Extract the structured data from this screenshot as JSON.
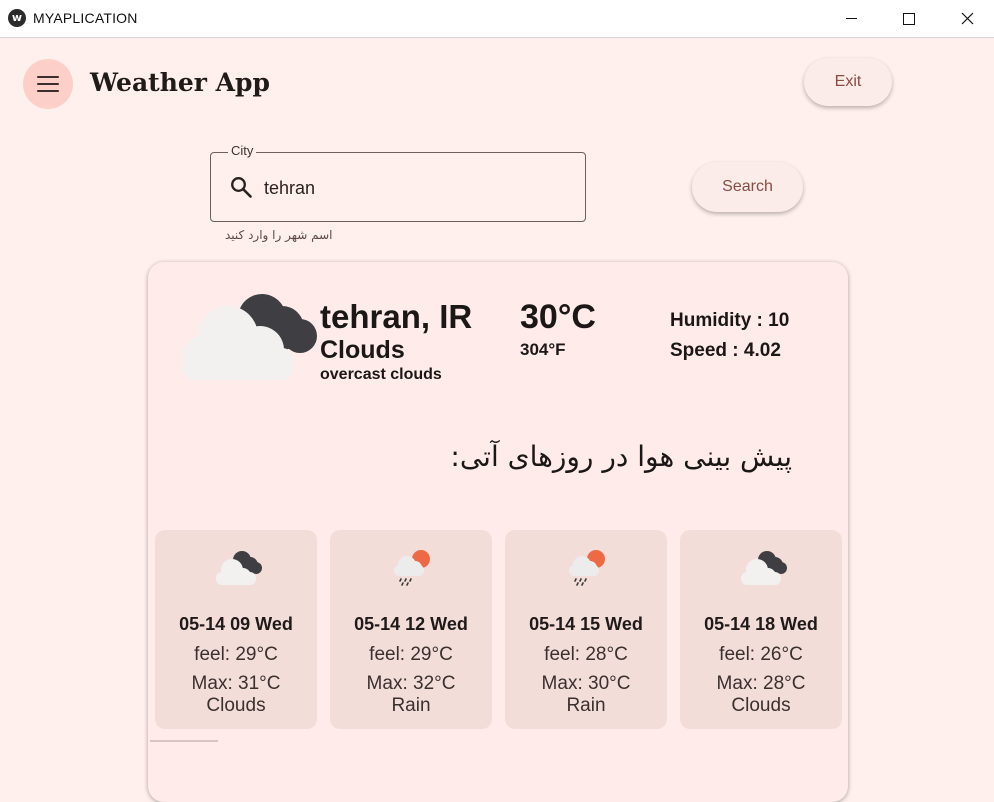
{
  "window": {
    "title": "MYAPLICATION",
    "icon_name": "kivy-logo-icon",
    "controls": [
      "minimize-icon",
      "maximize-icon",
      "close-icon"
    ]
  },
  "header": {
    "app_title": "Weather App",
    "exit_label": "Exit"
  },
  "search": {
    "field_label": "City",
    "value": "tehran",
    "helper_text": "اسم شهر را وارد کنید",
    "button_label": "Search"
  },
  "current": {
    "city": "tehran, IR",
    "main": "Clouds",
    "description": "overcast clouds",
    "temp_c": "30°C",
    "temp_f": "304°F",
    "humidity": "Humidity : 10",
    "speed": "Speed : 4.02",
    "icon": "overcast-clouds-icon"
  },
  "forecast_title": "پیش بینی هوا در روزهای آتی:",
  "forecast": [
    {
      "date": "05-14 09 Wed",
      "feel": "feel: 29°C",
      "max": "Max: 31°C",
      "condition": "Clouds",
      "icon": "clouds-icon"
    },
    {
      "date": "05-14 12 Wed",
      "feel": "feel: 29°C",
      "max": "Max: 32°C",
      "condition": "Rain",
      "icon": "rain-sun-icon"
    },
    {
      "date": "05-14 15 Wed",
      "feel": "feel: 28°C",
      "max": "Max: 30°C",
      "condition": "Rain",
      "icon": "rain-sun-icon"
    },
    {
      "date": "05-14 18 Wed",
      "feel": "feel: 26°C",
      "max": "Max: 28°C",
      "condition": "Clouds",
      "icon": "clouds-icon"
    }
  ],
  "colors": {
    "background": "#fff0ed",
    "card": "#ffecea",
    "forecast_card": "#f3ddd9",
    "menu_button": "#fcd0c8",
    "button_text": "#8a4b42"
  }
}
